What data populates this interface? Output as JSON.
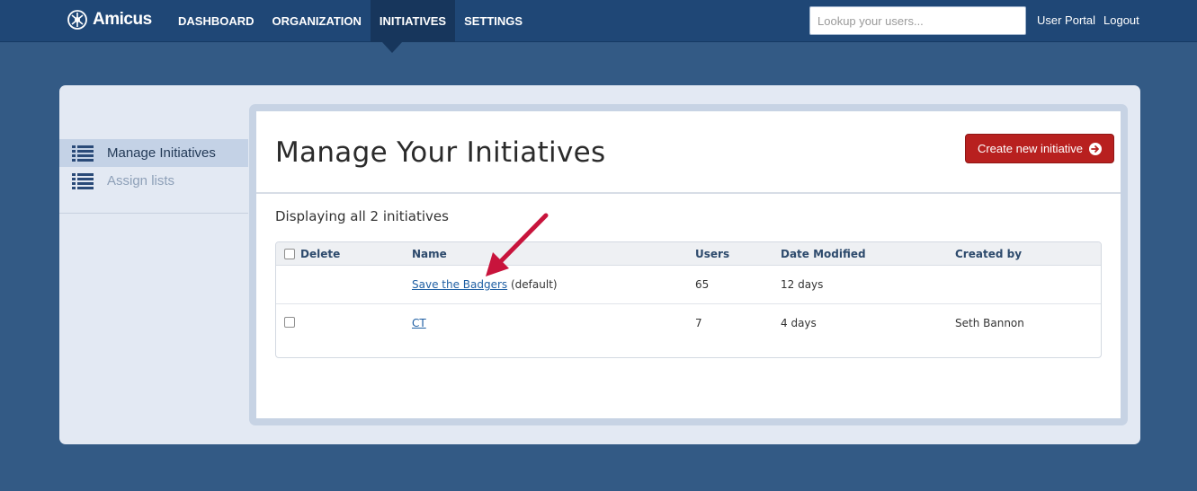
{
  "app": {
    "name": "Amicus"
  },
  "nav": {
    "items": [
      {
        "label": "DASHBOARD"
      },
      {
        "label": "ORGANIZATION"
      },
      {
        "label": "INITIATIVES",
        "active": true
      },
      {
        "label": "SETTINGS"
      }
    ]
  },
  "search": {
    "placeholder": "Lookup your users..."
  },
  "top_links": {
    "user_portal": "User Portal",
    "logout": "Logout"
  },
  "sidebar": {
    "items": [
      {
        "label": "Manage Initiatives",
        "active": true
      },
      {
        "label": "Assign lists",
        "active": false
      }
    ]
  },
  "main": {
    "title": "Manage Your Initiatives",
    "create_button": "Create new initiative",
    "count_text": "Displaying all 2 initiatives",
    "table": {
      "headers": {
        "delete": "Delete",
        "name": "Name",
        "users": "Users",
        "date_modified": "Date Modified",
        "created_by": "Created by"
      },
      "rows": [
        {
          "name": "Save the Badgers",
          "suffix": "(default)",
          "users": "65",
          "date_modified": "12 days",
          "created_by": ""
        },
        {
          "name": "CT",
          "suffix": "",
          "users": "7",
          "date_modified": "4 days",
          "created_by": "Seth Bannon"
        }
      ]
    }
  },
  "colors": {
    "page_bg": "#335a85",
    "topbar_bg": "#1f4776",
    "primary_button": "#b8201f",
    "link": "#1f5fa3",
    "annotation_arrow": "#c8143c"
  }
}
